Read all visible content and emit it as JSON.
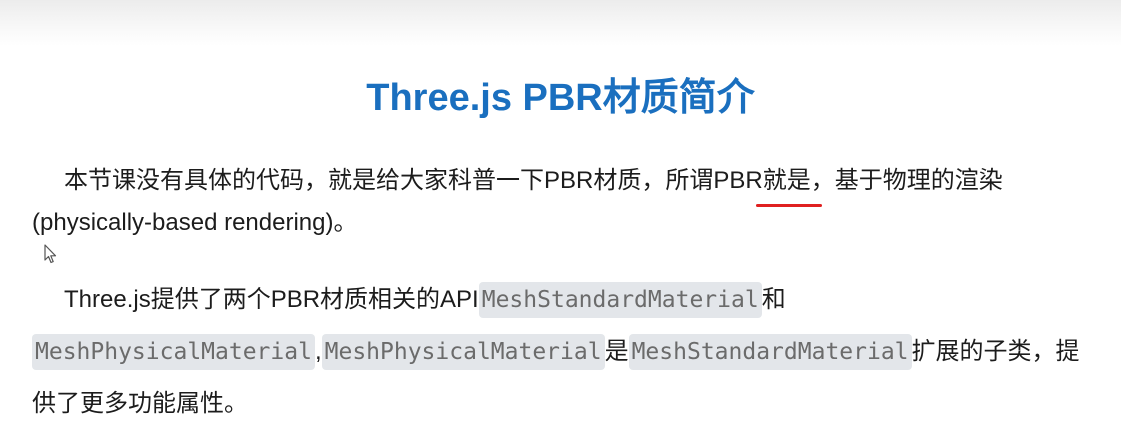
{
  "doc": {
    "title": "Three.js PBR材质简介",
    "p1": {
      "text": "本节课没有具体的代码，就是给大家科普一下PBR材质，所谓PBR就是，基于物理的渲染(physically-based rendering)。"
    },
    "p2": {
      "t1": "Three.js提供了两个PBR材质相关的API",
      "c1": "MeshStandardMaterial",
      "t2": "和",
      "c2": "MeshPhysicalMaterial",
      "t3": ",",
      "c3": "MeshPhysicalMaterial",
      "t4": "是",
      "c4": "MeshStandardMaterial",
      "t5": "扩展的子类，提供了更多功能属性。"
    }
  },
  "colors": {
    "title": "#1a6fbf",
    "annotation_underline": "#e02020",
    "code_bg": "#e3e6ea"
  },
  "icons": {
    "cursor": "mouse-pointer-icon"
  }
}
